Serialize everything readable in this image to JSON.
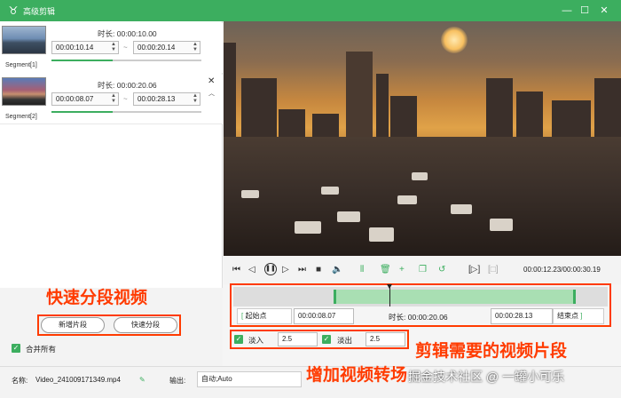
{
  "titlebar": {
    "app_title": "高级剪辑",
    "logo_glyph": "♉",
    "minimize": "—",
    "maximize": "☐",
    "close": "✕"
  },
  "segments": [
    {
      "label": "Segment[1]",
      "duration_label": "时长:",
      "duration": "00:00:10.00",
      "start": "00:00:10.14",
      "end": "00:00:20.14",
      "progress": 0.41
    },
    {
      "label": "Segment[2]",
      "duration_label": "时长:",
      "duration": "00:00:20.06",
      "start": "00:00:08.07",
      "end": "00:00:28.13",
      "progress": 0.41
    }
  ],
  "sidebar_actions": {
    "new_segment": "新增片段",
    "quick_split": "快速分段",
    "merge_all": "合并所有"
  },
  "annotations": {
    "quick_split": "快速分段视频",
    "edit_clip": "剪辑需要的视频片段",
    "add_fade": "增加视频转场"
  },
  "playback": {
    "time_current": "00:00:12.23",
    "time_total": "00:00:30.19",
    "separator": "/"
  },
  "trim": {
    "start_label": "起始点",
    "start_value": "00:00:08.07",
    "duration_label": "时长:",
    "duration_value": "00:00:20.06",
    "end_value": "00:00:28.13",
    "end_label": "结束点",
    "bracket_left": "[",
    "bracket_right": "]"
  },
  "fade": {
    "fade_in_label": "淡入",
    "fade_in_value": "2.5",
    "fade_out_label": "淡出",
    "fade_out_value": "2.5"
  },
  "footer": {
    "name_label": "名称:",
    "file_name": "Video_241009171349.mp4",
    "output_label": "输出:",
    "output_value": "自动;Auto"
  },
  "watermark": "掘金技术社区 @ 一罐小可乐",
  "colors": {
    "accent": "#3cae5f",
    "annotation": "#ff3b00"
  }
}
